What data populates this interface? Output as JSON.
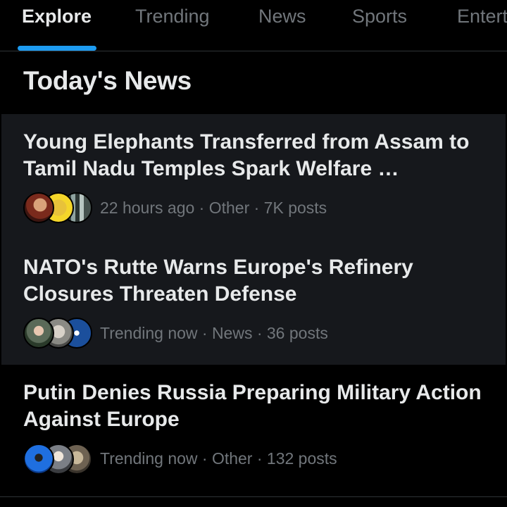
{
  "tabs": [
    {
      "label": "Explore",
      "active": true
    },
    {
      "label": "Trending",
      "active": false
    },
    {
      "label": "News",
      "active": false
    },
    {
      "label": "Sports",
      "active": false
    },
    {
      "label": "Entertainment",
      "active": false
    }
  ],
  "section": {
    "title": "Today's News"
  },
  "news": [
    {
      "headline": "Young Elephants Transferred from Assam to Tamil Nadu Temples Spark Welfare …",
      "time": "22 hours ago",
      "category": "Other",
      "posts": "7K posts",
      "meta": "22 hours ago · Other · 7K posts"
    },
    {
      "headline": "NATO's Rutte Warns Europe's Refinery Closures Threaten Defense",
      "time": "Trending now",
      "category": "News",
      "posts": "36 posts",
      "meta": "Trending now · News · 36 posts"
    },
    {
      "headline": "Putin Denies Russia Preparing Military Action Against Europe",
      "time": "Trending now",
      "category": "Other",
      "posts": "132 posts",
      "meta": "Trending now · Other · 132 posts"
    }
  ],
  "colors": {
    "background": "#000000",
    "accent": "#1d9bf0",
    "text_primary": "#e7e9ea",
    "text_secondary": "#71767b",
    "highlight": "#16181c"
  }
}
